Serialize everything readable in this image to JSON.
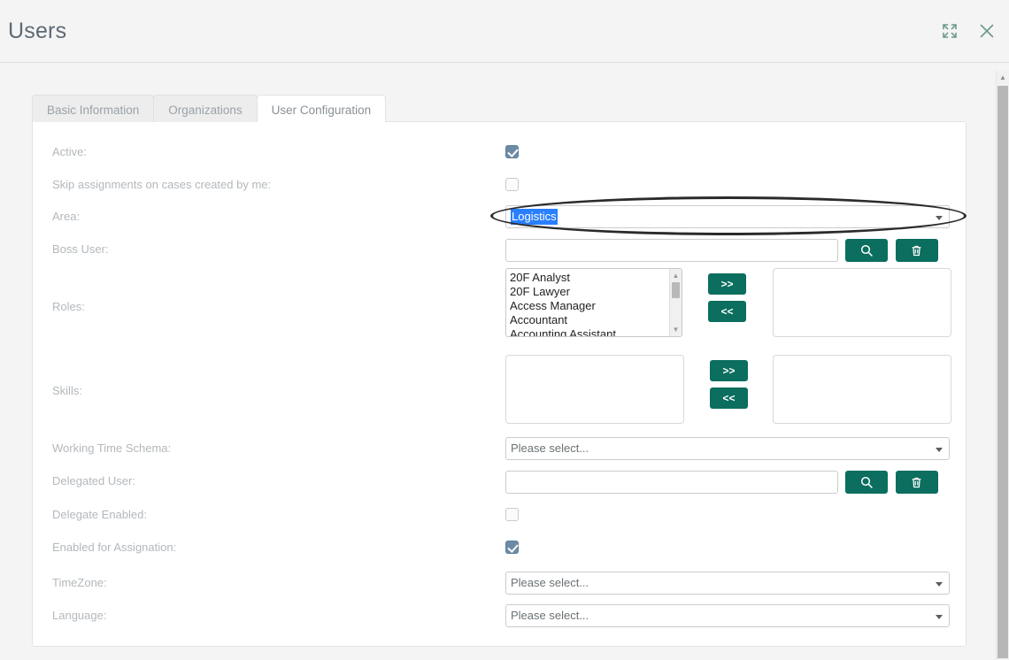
{
  "header": {
    "title": "Users",
    "expand_icon": "expand-icon",
    "close_icon": "close-icon"
  },
  "tabs": [
    {
      "label": "Basic Information",
      "active": false
    },
    {
      "label": "Organizations",
      "active": false
    },
    {
      "label": "User Configuration",
      "active": true
    }
  ],
  "form": {
    "active": {
      "label": "Active:",
      "checked": true
    },
    "skip_assignments": {
      "label": "Skip assignments on cases created by me:",
      "checked": false
    },
    "area": {
      "label": "Area:",
      "value": "Logistics",
      "highlighted": true
    },
    "boss_user": {
      "label": "Boss User:",
      "value": "",
      "placeholder": "",
      "search_button": "search-icon",
      "clear_button": "trash-icon"
    },
    "roles": {
      "label": "Roles:",
      "available": [
        "20F Analyst",
        "20F Lawyer",
        "Access Manager",
        "Accountant",
        "Accounting Assistant"
      ],
      "selected": [],
      "add_label": ">>",
      "remove_label": "<<"
    },
    "skills": {
      "label": "Skills:",
      "available": [],
      "selected": [],
      "add_label": ">>",
      "remove_label": "<<"
    },
    "working_time_schema": {
      "label": "Working Time Schema:",
      "value": "Please select..."
    },
    "delegated_user": {
      "label": "Delegated User:",
      "value": "",
      "placeholder": "",
      "search_button": "search-icon",
      "clear_button": "trash-icon"
    },
    "delegate_enabled": {
      "label": "Delegate Enabled:",
      "checked": false
    },
    "enabled_for_assignation": {
      "label": "Enabled for Assignation:",
      "checked": true
    },
    "timezone": {
      "label": "TimeZone:",
      "value": "Please select..."
    },
    "language": {
      "label": "Language:",
      "value": "Please select..."
    }
  },
  "colors": {
    "accent_green": "#0b6e5f",
    "checkbox_checked": "#6d8ba5",
    "selection_blue": "#2a7fff",
    "title_text": "#5d6a75",
    "label_text": "#b3b8bc",
    "annotation": "#2b2b2b"
  }
}
